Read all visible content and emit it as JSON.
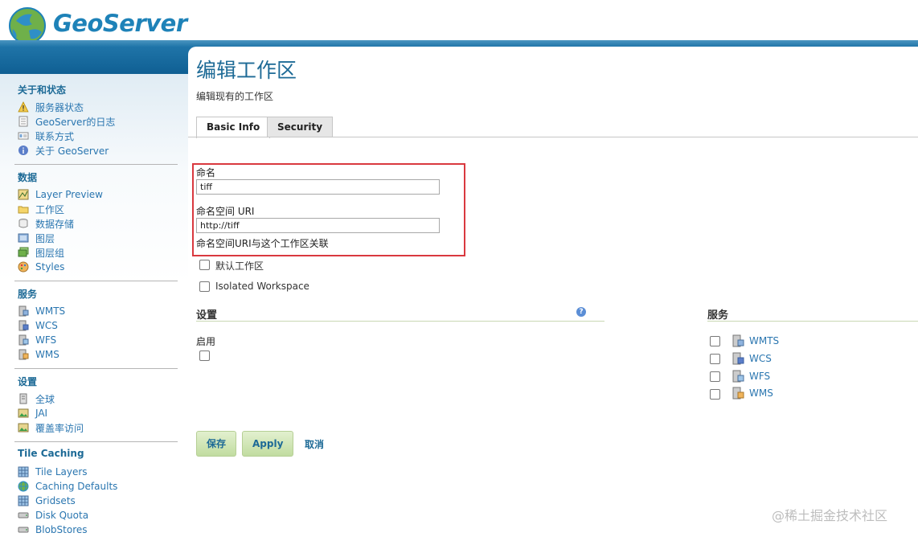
{
  "header": {
    "logo_text": "GeoServer"
  },
  "sidebar": {
    "sections": [
      {
        "title": "关于和状态",
        "items": [
          {
            "label": "服务器状态",
            "icon": "server-status-icon"
          },
          {
            "label": "GeoServer的日志",
            "icon": "log-file-icon"
          },
          {
            "label": "联系方式",
            "icon": "contact-card-icon"
          },
          {
            "label": "关于 GeoServer",
            "icon": "info-icon"
          }
        ]
      },
      {
        "title": "数据",
        "items": [
          {
            "label": "Layer Preview",
            "icon": "layer-preview-icon"
          },
          {
            "label": "工作区",
            "icon": "folder-icon"
          },
          {
            "label": "数据存储",
            "icon": "datastore-icon"
          },
          {
            "label": "图层",
            "icon": "layer-icon"
          },
          {
            "label": "图层组",
            "icon": "layer-group-icon"
          },
          {
            "label": "Styles",
            "icon": "palette-icon"
          }
        ]
      },
      {
        "title": "服务",
        "items": [
          {
            "label": "WMTS",
            "icon": "service-icon"
          },
          {
            "label": "WCS",
            "icon": "service-icon"
          },
          {
            "label": "WFS",
            "icon": "service-icon"
          },
          {
            "label": "WMS",
            "icon": "service-icon"
          }
        ]
      },
      {
        "title": "设置",
        "items": [
          {
            "label": "全球",
            "icon": "server-icon"
          },
          {
            "label": "JAI",
            "icon": "image-icon"
          },
          {
            "label": "覆盖率访问",
            "icon": "image-icon"
          }
        ]
      },
      {
        "title": "Tile Caching",
        "items": [
          {
            "label": "Tile Layers",
            "icon": "grid-icon"
          },
          {
            "label": "Caching Defaults",
            "icon": "globe-icon"
          },
          {
            "label": "Gridsets",
            "icon": "grid-icon"
          },
          {
            "label": "Disk Quota",
            "icon": "disk-icon"
          },
          {
            "label": "BlobStores",
            "icon": "disk-icon"
          }
        ]
      }
    ]
  },
  "main": {
    "title": "编辑工作区",
    "description": "编辑现有的工作区",
    "tabs": [
      {
        "label": "Basic Info",
        "active": true
      },
      {
        "label": "Security",
        "active": false
      }
    ],
    "form": {
      "name_label": "命名",
      "name_value": "tiff",
      "uri_label": "命名空间 URI",
      "uri_value": "http://tiff",
      "uri_hint": "命名空间URI与这个工作区关联",
      "default_ws_label": "默认工作区",
      "default_ws_checked": false,
      "isolated_label": "Isolated Workspace",
      "isolated_checked": false
    },
    "settings": {
      "heading": "设置",
      "enabled_label": "启用",
      "enabled_checked": false
    },
    "services": {
      "heading": "服务",
      "items": [
        {
          "label": "WMTS",
          "checked": false
        },
        {
          "label": "WCS",
          "checked": false
        },
        {
          "label": "WFS",
          "checked": false
        },
        {
          "label": "WMS",
          "checked": false
        }
      ]
    },
    "buttons": {
      "save": "保存",
      "apply": "Apply",
      "cancel": "取消"
    }
  },
  "watermark": "@稀土掘金技术社区",
  "colors": {
    "accent": "#1d6a96",
    "link": "#2a76b0",
    "highlight_box": "#d9393f",
    "topbar": "#0f5f93"
  }
}
